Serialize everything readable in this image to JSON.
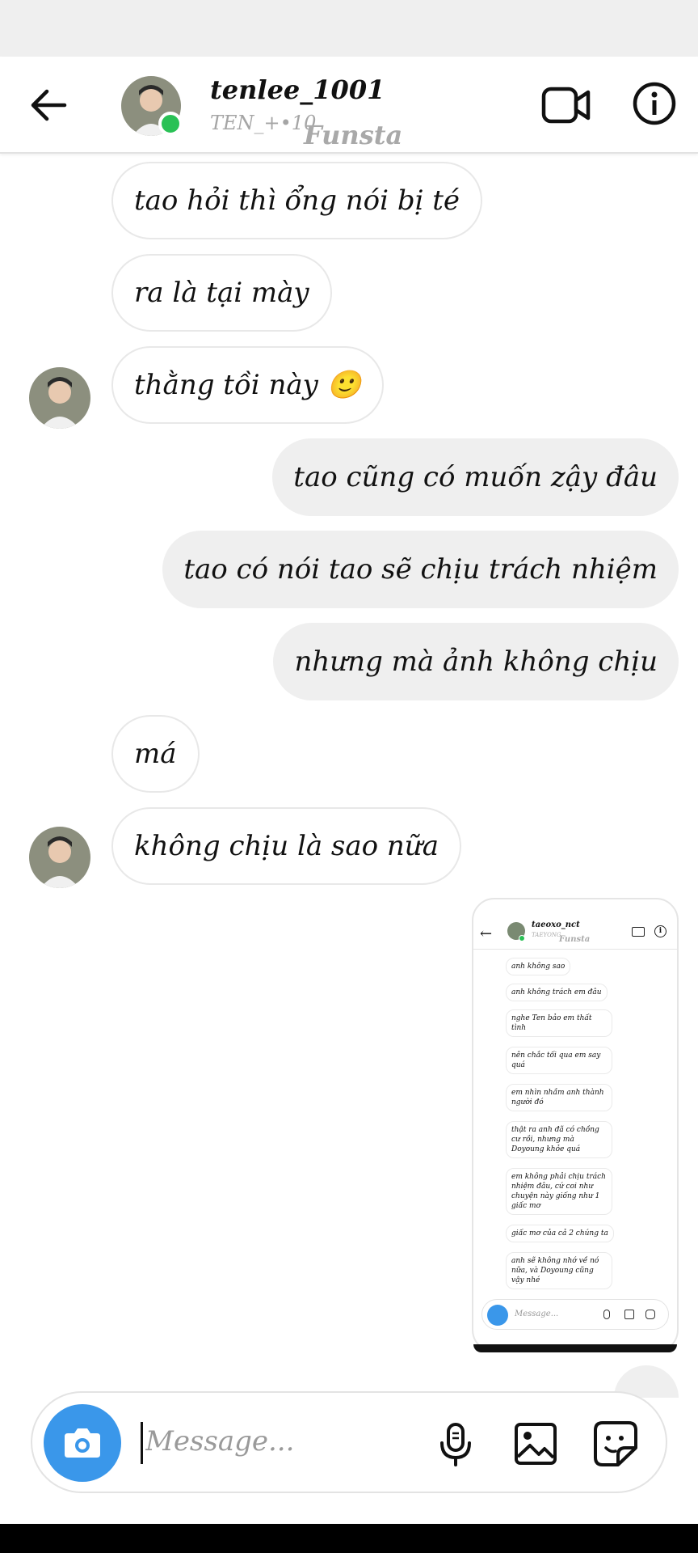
{
  "header": {
    "username": "tenlee_1001",
    "subtitle": "TEN_+•10",
    "brand": "Funsta"
  },
  "messages": [
    {
      "side": "in",
      "text": "tao hỏi thì ổng nói bị té"
    },
    {
      "side": "in",
      "text": "ra là tại mày"
    },
    {
      "side": "in",
      "text": "thằng tồi này 🙂"
    },
    {
      "side": "out",
      "text": "tao cũng có muốn zậy đâu"
    },
    {
      "side": "out",
      "text": "tao có nói tao sẽ chịu trách nhiệm"
    },
    {
      "side": "out",
      "text": "nhưng mà ảnh không chịu"
    },
    {
      "side": "in",
      "text": "má"
    },
    {
      "side": "in",
      "text": "không chịu là sao nữa"
    }
  ],
  "shared_screenshot": {
    "username": "taeoxo_nct",
    "subtitle": "TAEYONG",
    "brand": "Funsta",
    "messages": [
      "anh không sao",
      "anh không trách em đâu",
      "nghe Ten bảo em thất tình",
      "nên chắc tối qua em say quá",
      "em nhìn nhầm anh thành người đó",
      "thật ra anh đã có chồng cư rồi, nhưng mà Doyoung khỏe quá",
      "em không phải chịu trách nhiệm đâu, cứ coi như chuyện này giống như 1 giấc mơ",
      "giấc mơ của cả 2 chúng ta",
      "anh sẽ không nhớ về nó nữa, và Doyoung cũng vậy nhé"
    ],
    "placeholder": "Message..."
  },
  "composer": {
    "placeholder": "Message..."
  },
  "icons": {
    "back": "arrow-left-icon",
    "video": "video-camera-icon",
    "info": "info-icon",
    "camera": "camera-icon",
    "mic": "microphone-icon",
    "gallery": "image-icon",
    "sticker": "sticker-icon"
  },
  "colors": {
    "accent": "#3a97ea",
    "online": "#29c155",
    "outgoing_bubble": "#efefef"
  }
}
